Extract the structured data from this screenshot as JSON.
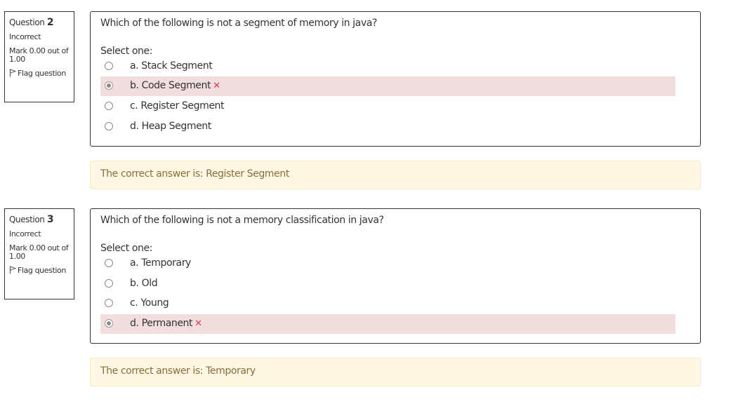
{
  "questions": [
    {
      "number_prefix": "Question",
      "number": "2",
      "state": "Incorrect",
      "grade": "Mark 0.00 out of 1.00",
      "flag_label": "Flag question",
      "text": "Which of the following is not a segment of memory in java?",
      "prompt": "Select one:",
      "options": [
        {
          "label": "a. Stack Segment",
          "selected": false,
          "incorrect": false
        },
        {
          "label": "b. Code Segment",
          "selected": true,
          "incorrect": true,
          "mark": "✕"
        },
        {
          "label": "c. Register Segment",
          "selected": false,
          "incorrect": false
        },
        {
          "label": "d. Heap Segment",
          "selected": false,
          "incorrect": false
        }
      ],
      "feedback": "The correct answer is: Register Segment"
    },
    {
      "number_prefix": "Question",
      "number": "3",
      "state": "Incorrect",
      "grade": "Mark 0.00 out of 1.00",
      "flag_label": "Flag question",
      "text": "Which of the following is not a memory classification in java?",
      "prompt": "Select one:",
      "options": [
        {
          "label": "a. Temporary",
          "selected": false,
          "incorrect": false
        },
        {
          "label": "b. Old",
          "selected": false,
          "incorrect": false
        },
        {
          "label": "c. Young",
          "selected": false,
          "incorrect": false
        },
        {
          "label": "d. Permanent",
          "selected": true,
          "incorrect": true,
          "mark": "✕"
        }
      ],
      "feedback": "The correct answer is: Temporary"
    }
  ],
  "colors": {
    "incorrect_bg": "#f2dedf",
    "incorrect_mark": "#e8393b",
    "feedback_bg": "#fdf7e3",
    "feedback_text": "#8a6d3b",
    "border": "#333333"
  }
}
